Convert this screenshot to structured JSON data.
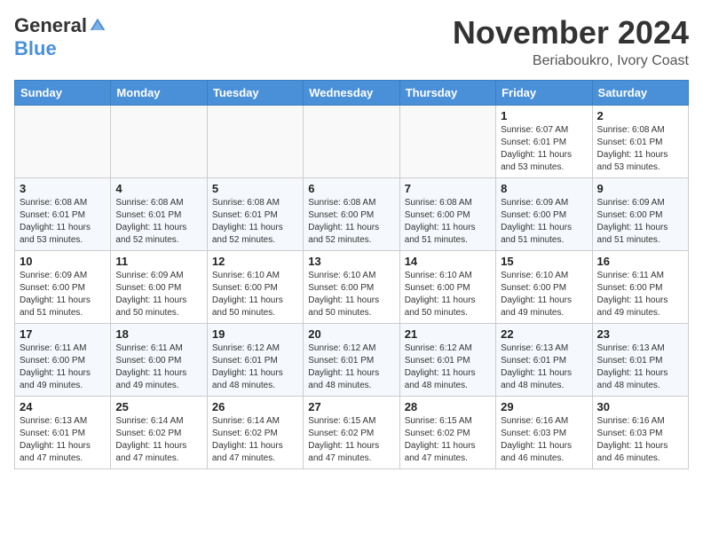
{
  "header": {
    "logo_general": "General",
    "logo_blue": "Blue",
    "month": "November 2024",
    "location": "Beriaboukro, Ivory Coast"
  },
  "weekdays": [
    "Sunday",
    "Monday",
    "Tuesday",
    "Wednesday",
    "Thursday",
    "Friday",
    "Saturday"
  ],
  "weeks": [
    [
      {
        "day": "",
        "info": ""
      },
      {
        "day": "",
        "info": ""
      },
      {
        "day": "",
        "info": ""
      },
      {
        "day": "",
        "info": ""
      },
      {
        "day": "",
        "info": ""
      },
      {
        "day": "1",
        "info": "Sunrise: 6:07 AM\nSunset: 6:01 PM\nDaylight: 11 hours and 53 minutes."
      },
      {
        "day": "2",
        "info": "Sunrise: 6:08 AM\nSunset: 6:01 PM\nDaylight: 11 hours and 53 minutes."
      }
    ],
    [
      {
        "day": "3",
        "info": "Sunrise: 6:08 AM\nSunset: 6:01 PM\nDaylight: 11 hours and 53 minutes."
      },
      {
        "day": "4",
        "info": "Sunrise: 6:08 AM\nSunset: 6:01 PM\nDaylight: 11 hours and 52 minutes."
      },
      {
        "day": "5",
        "info": "Sunrise: 6:08 AM\nSunset: 6:01 PM\nDaylight: 11 hours and 52 minutes."
      },
      {
        "day": "6",
        "info": "Sunrise: 6:08 AM\nSunset: 6:00 PM\nDaylight: 11 hours and 52 minutes."
      },
      {
        "day": "7",
        "info": "Sunrise: 6:08 AM\nSunset: 6:00 PM\nDaylight: 11 hours and 51 minutes."
      },
      {
        "day": "8",
        "info": "Sunrise: 6:09 AM\nSunset: 6:00 PM\nDaylight: 11 hours and 51 minutes."
      },
      {
        "day": "9",
        "info": "Sunrise: 6:09 AM\nSunset: 6:00 PM\nDaylight: 11 hours and 51 minutes."
      }
    ],
    [
      {
        "day": "10",
        "info": "Sunrise: 6:09 AM\nSunset: 6:00 PM\nDaylight: 11 hours and 51 minutes."
      },
      {
        "day": "11",
        "info": "Sunrise: 6:09 AM\nSunset: 6:00 PM\nDaylight: 11 hours and 50 minutes."
      },
      {
        "day": "12",
        "info": "Sunrise: 6:10 AM\nSunset: 6:00 PM\nDaylight: 11 hours and 50 minutes."
      },
      {
        "day": "13",
        "info": "Sunrise: 6:10 AM\nSunset: 6:00 PM\nDaylight: 11 hours and 50 minutes."
      },
      {
        "day": "14",
        "info": "Sunrise: 6:10 AM\nSunset: 6:00 PM\nDaylight: 11 hours and 50 minutes."
      },
      {
        "day": "15",
        "info": "Sunrise: 6:10 AM\nSunset: 6:00 PM\nDaylight: 11 hours and 49 minutes."
      },
      {
        "day": "16",
        "info": "Sunrise: 6:11 AM\nSunset: 6:00 PM\nDaylight: 11 hours and 49 minutes."
      }
    ],
    [
      {
        "day": "17",
        "info": "Sunrise: 6:11 AM\nSunset: 6:00 PM\nDaylight: 11 hours and 49 minutes."
      },
      {
        "day": "18",
        "info": "Sunrise: 6:11 AM\nSunset: 6:00 PM\nDaylight: 11 hours and 49 minutes."
      },
      {
        "day": "19",
        "info": "Sunrise: 6:12 AM\nSunset: 6:01 PM\nDaylight: 11 hours and 48 minutes."
      },
      {
        "day": "20",
        "info": "Sunrise: 6:12 AM\nSunset: 6:01 PM\nDaylight: 11 hours and 48 minutes."
      },
      {
        "day": "21",
        "info": "Sunrise: 6:12 AM\nSunset: 6:01 PM\nDaylight: 11 hours and 48 minutes."
      },
      {
        "day": "22",
        "info": "Sunrise: 6:13 AM\nSunset: 6:01 PM\nDaylight: 11 hours and 48 minutes."
      },
      {
        "day": "23",
        "info": "Sunrise: 6:13 AM\nSunset: 6:01 PM\nDaylight: 11 hours and 48 minutes."
      }
    ],
    [
      {
        "day": "24",
        "info": "Sunrise: 6:13 AM\nSunset: 6:01 PM\nDaylight: 11 hours and 47 minutes."
      },
      {
        "day": "25",
        "info": "Sunrise: 6:14 AM\nSunset: 6:02 PM\nDaylight: 11 hours and 47 minutes."
      },
      {
        "day": "26",
        "info": "Sunrise: 6:14 AM\nSunset: 6:02 PM\nDaylight: 11 hours and 47 minutes."
      },
      {
        "day": "27",
        "info": "Sunrise: 6:15 AM\nSunset: 6:02 PM\nDaylight: 11 hours and 47 minutes."
      },
      {
        "day": "28",
        "info": "Sunrise: 6:15 AM\nSunset: 6:02 PM\nDaylight: 11 hours and 47 minutes."
      },
      {
        "day": "29",
        "info": "Sunrise: 6:16 AM\nSunset: 6:03 PM\nDaylight: 11 hours and 46 minutes."
      },
      {
        "day": "30",
        "info": "Sunrise: 6:16 AM\nSunset: 6:03 PM\nDaylight: 11 hours and 46 minutes."
      }
    ]
  ]
}
